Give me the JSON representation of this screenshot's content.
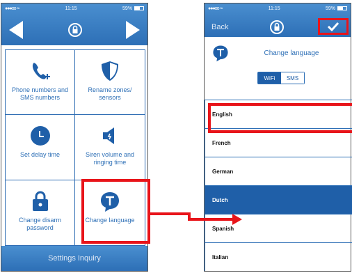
{
  "left_screen": {
    "status": {
      "signal": "●●●oo",
      "wifi": "≈",
      "time": "11:15",
      "battery": "59%"
    },
    "footer_label": "Settings Inquiry",
    "grid_items": [
      {
        "label": "Phone numbers and SMS numbers",
        "icon": "phone-plus-icon"
      },
      {
        "label": "Rename zones/ sensors",
        "icon": "shield-icon"
      },
      {
        "label": "Set delay time",
        "icon": "clock-icon"
      },
      {
        "label": "Siren volume and ringing time",
        "icon": "speaker-icon"
      },
      {
        "label": "Change disarm password",
        "icon": "lock-icon"
      },
      {
        "label": "Change language",
        "icon": "language-t-icon"
      }
    ]
  },
  "right_screen": {
    "status": {
      "signal": "●●●oo",
      "wifi": "≈",
      "time": "11:15",
      "battery": "59%"
    },
    "back_label": "Back",
    "confirm_icon": "checkmark-icon",
    "title": "Change language",
    "toggle": {
      "options": [
        "WiFi",
        "SMS"
      ],
      "selected": "WiFi"
    },
    "languages": [
      {
        "label": "English",
        "selected": false
      },
      {
        "label": "French",
        "selected": false
      },
      {
        "label": "German",
        "selected": false
      },
      {
        "label": "Dutch",
        "selected": true
      },
      {
        "label": "Spanish",
        "selected": false
      },
      {
        "label": "Italian",
        "selected": false
      }
    ]
  },
  "colors": {
    "header_blue": "#2d6fb6",
    "selection_blue": "#1f5fa8",
    "callout_red": "#e8141a"
  }
}
